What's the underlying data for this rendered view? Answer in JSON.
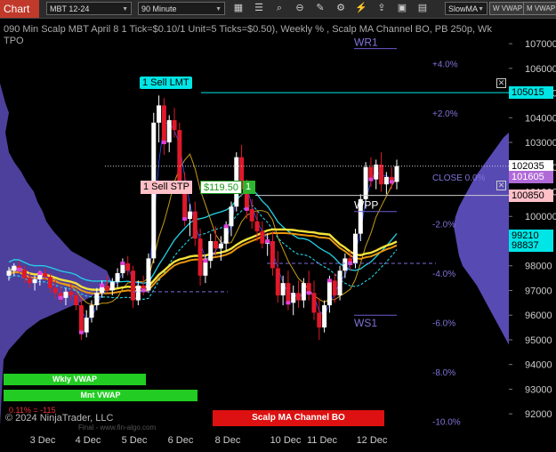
{
  "toolbar": {
    "title": "Chart",
    "instrument": "MBT 12-24",
    "interval": "90 Minute",
    "icons": [
      "bar-type-icon",
      "data-box-icon",
      "draw-tools-icon",
      "zoom-icon",
      "zoom-out-icon",
      "properties-icon",
      "template-icon",
      "strategy-icon",
      "share-icon",
      "chart-trader-icon"
    ],
    "indicator_select": "SlowMA",
    "buttons": [
      "W VWAP",
      "M VWAP"
    ]
  },
  "chart_title": "090 Min Scalp MBT April 8 1 Tick=$0.10/1 Unit=5 Ticks=$0.50), Weekly % , Scalp MA Channel BO, PB 250p, Wk TPO",
  "copyright": "© 2024 NinjaTrader, LLC",
  "watermark": "Final - www.fin-algo.com",
  "chart_data": {
    "type": "candlestick",
    "x_labels": [
      "3 Dec",
      "4 Dec",
      "5 Dec",
      "6 Dec",
      "8 Dec",
      "10 Dec",
      "11 Dec",
      "12 Dec"
    ],
    "y_ticks": [
      92000,
      93000,
      94000,
      95000,
      96000,
      97000,
      98000,
      99000,
      100000,
      101000,
      102000,
      103000,
      104000,
      105000,
      106000,
      107000
    ],
    "ylim": [
      91500,
      107400
    ],
    "price_tags": [
      {
        "label": "105015",
        "value": 105015,
        "color": "#00e5e5"
      },
      {
        "label": "102035",
        "value": 102035,
        "color": "#ffffff"
      },
      {
        "label": "101605",
        "value": 101605,
        "color": "#b06ad8"
      },
      {
        "label": "100850",
        "value": 100850,
        "color": "#ffc0c8"
      },
      {
        "label": "99210",
        "value": 99210,
        "color": "#00e5e5"
      },
      {
        "label": "98837",
        "value": 98837,
        "color": "#00e5e5"
      }
    ],
    "pct_levels": [
      {
        "label": "+4.0%",
        "value": 106200
      },
      {
        "label": "+2.0%",
        "value": 104200
      },
      {
        "label": "CLOSE 0.0%",
        "value": 101600
      },
      {
        "label": "-2.0%",
        "value": 99700
      },
      {
        "label": "-4.0%",
        "value": 97700
      },
      {
        "label": "-6.0%",
        "value": 95700
      },
      {
        "label": "-8.0%",
        "value": 93700
      },
      {
        "label": "-10.0%",
        "value": 91700
      }
    ],
    "levels": [
      {
        "label": "WR1",
        "value": 106800
      },
      {
        "label": "WPP",
        "value": 100200
      },
      {
        "label": "WS1",
        "value": 96000
      }
    ],
    "orders": [
      {
        "label": "1 Sell LMT",
        "value": 105015
      },
      {
        "label": "1 Sell STP",
        "value": 100850,
        "pnl": "$119.50",
        "qty": "1"
      }
    ],
    "position_pnl": "0.11% = -115",
    "bottom_labels": [
      "Wkly VWAP",
      "Mnt VWAP",
      "Scalp MA Channel BO"
    ],
    "candles": [
      [
        97.6,
        97.95,
        97.4,
        97.8
      ],
      [
        97.8,
        98.1,
        97.6,
        98.0
      ],
      [
        98.0,
        98.2,
        97.7,
        97.85
      ],
      [
        97.85,
        98.0,
        97.3,
        97.5
      ],
      [
        97.5,
        97.7,
        97.1,
        97.3
      ],
      [
        97.3,
        97.6,
        97.0,
        97.45
      ],
      [
        97.45,
        97.8,
        97.2,
        97.7
      ],
      [
        97.7,
        97.9,
        97.4,
        97.55
      ],
      [
        97.55,
        97.7,
        96.9,
        97.1
      ],
      [
        97.1,
        97.4,
        96.7,
        96.9
      ],
      [
        96.9,
        97.2,
        96.5,
        96.7
      ],
      [
        96.7,
        97.1,
        96.4,
        96.95
      ],
      [
        96.95,
        97.3,
        96.6,
        96.8
      ],
      [
        96.8,
        97.0,
        96.2,
        96.4
      ],
      [
        96.4,
        96.7,
        95.0,
        95.3
      ],
      [
        95.3,
        96.2,
        95.1,
        95.9
      ],
      [
        95.9,
        96.6,
        95.7,
        96.4
      ],
      [
        96.4,
        97.1,
        96.2,
        96.9
      ],
      [
        96.9,
        97.4,
        96.7,
        97.2
      ],
      [
        97.2,
        97.6,
        96.9,
        97.0
      ],
      [
        97.0,
        97.5,
        96.8,
        97.35
      ],
      [
        97.35,
        97.9,
        97.1,
        97.7
      ],
      [
        97.7,
        98.3,
        97.5,
        98.1
      ],
      [
        98.1,
        98.4,
        97.6,
        97.8
      ],
      [
        97.8,
        98.0,
        96.3,
        96.6
      ],
      [
        96.6,
        97.4,
        96.4,
        97.2
      ],
      [
        97.2,
        97.6,
        96.8,
        97.0
      ],
      [
        97.0,
        98.5,
        96.9,
        98.3
      ],
      [
        98.3,
        104.2,
        98.1,
        103.8
      ],
      [
        103.8,
        104.9,
        103.0,
        104.5
      ],
      [
        104.5,
        104.8,
        102.5,
        103.0
      ],
      [
        103.0,
        104.1,
        102.6,
        103.9
      ],
      [
        103.9,
        104.4,
        103.2,
        103.5
      ],
      [
        103.5,
        103.8,
        101.0,
        101.4
      ],
      [
        101.4,
        101.8,
        99.6,
        99.9
      ],
      [
        99.9,
        100.5,
        99.2,
        100.2
      ],
      [
        100.2,
        100.6,
        98.8,
        99.1
      ],
      [
        99.1,
        99.5,
        97.2,
        97.6
      ],
      [
        97.6,
        98.4,
        97.3,
        98.2
      ],
      [
        98.2,
        99.3,
        97.9,
        99.0
      ],
      [
        99.0,
        99.6,
        98.4,
        98.7
      ],
      [
        98.7,
        99.2,
        98.2,
        98.9
      ],
      [
        98.9,
        99.8,
        98.6,
        99.6
      ],
      [
        99.6,
        100.6,
        99.2,
        100.4
      ],
      [
        100.4,
        102.6,
        100.2,
        102.4
      ],
      [
        102.4,
        102.9,
        100.8,
        101.1
      ],
      [
        101.1,
        101.5,
        99.9,
        100.3
      ],
      [
        100.3,
        100.7,
        99.5,
        99.8
      ],
      [
        99.8,
        100.2,
        99.0,
        99.4
      ],
      [
        99.4,
        99.8,
        98.7,
        98.9
      ],
      [
        98.9,
        99.3,
        98.4,
        99.0
      ],
      [
        99.0,
        99.4,
        97.6,
        97.9
      ],
      [
        97.9,
        98.6,
        96.5,
        96.8
      ],
      [
        96.8,
        97.6,
        96.4,
        97.3
      ],
      [
        97.3,
        97.8,
        96.2,
        96.5
      ],
      [
        96.5,
        97.2,
        96.0,
        96.9
      ],
      [
        96.9,
        97.4,
        96.3,
        96.6
      ],
      [
        96.6,
        97.5,
        96.3,
        97.3
      ],
      [
        97.3,
        97.8,
        96.6,
        96.9
      ],
      [
        96.9,
        97.4,
        95.8,
        96.1
      ],
      [
        96.1,
        96.7,
        95.0,
        95.5
      ],
      [
        95.5,
        96.6,
        95.3,
        96.4
      ],
      [
        96.4,
        97.6,
        96.1,
        97.4
      ],
      [
        97.4,
        97.7,
        96.5,
        96.8
      ],
      [
        96.8,
        98.0,
        96.6,
        97.8
      ],
      [
        97.8,
        98.5,
        97.5,
        98.3
      ],
      [
        98.3,
        98.6,
        97.8,
        98.1
      ],
      [
        98.1,
        99.5,
        97.9,
        99.3
      ],
      [
        99.3,
        100.9,
        99.0,
        100.7
      ],
      [
        100.7,
        102.2,
        100.4,
        102.0
      ],
      [
        102.0,
        102.4,
        101.2,
        101.5
      ],
      [
        101.5,
        102.3,
        101.1,
        102.1
      ],
      [
        102.1,
        102.6,
        101.0,
        101.3
      ],
      [
        101.3,
        101.8,
        100.9,
        101.6
      ],
      [
        101.6,
        102.0,
        101.1,
        101.4
      ],
      [
        101.4,
        102.3,
        101.1,
        102.04
      ]
    ]
  }
}
